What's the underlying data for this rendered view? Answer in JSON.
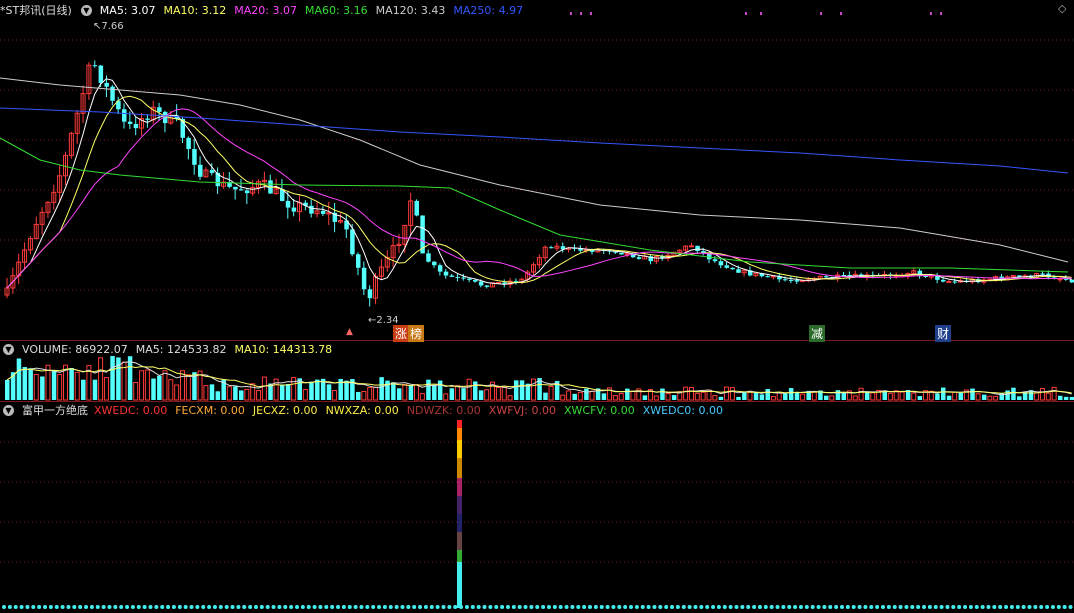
{
  "main": {
    "stock_title": "*ST邦讯(日线)",
    "indicators": [
      {
        "label": "MA5: 3.07",
        "color": "#ffffff"
      },
      {
        "label": "MA10: 3.12",
        "color": "#ffff66"
      },
      {
        "label": "MA20: 3.07",
        "color": "#ff44ff"
      },
      {
        "label": "MA60: 3.16",
        "color": "#33dd33"
      },
      {
        "label": "MA120: 3.43",
        "color": "#cccccc"
      },
      {
        "label": "MA250: 4.97",
        "color": "#3355ff"
      }
    ],
    "high_label": "7.66",
    "low_label": "2.34",
    "tags": [
      {
        "text": "涨",
        "bg": "#c83c14",
        "fg": "#ffffff"
      },
      {
        "text": "榜",
        "bg": "#c87814",
        "fg": "#ffffff"
      },
      {
        "text": "减",
        "bg": "#2a6a2a",
        "fg": "#ffffff"
      },
      {
        "text": "财",
        "bg": "#1f3f8a",
        "fg": "#ffffff"
      }
    ],
    "corner_icon": "◇"
  },
  "volume": {
    "title": "VOLUME: 86922.07",
    "ma5": "MA5: 124533.82",
    "ma10": "MA10: 144313.78"
  },
  "indicator_panel": {
    "title": "富甲一方绝底",
    "items": [
      {
        "label": "XWEDC: 0.00",
        "color": "#ff3333"
      },
      {
        "label": "FECXM: 0.00",
        "color": "#ffaa33"
      },
      {
        "label": "JECXZ: 0.00",
        "color": "#ffee44"
      },
      {
        "label": "NWXZA: 0.00",
        "color": "#ffee44"
      },
      {
        "label": "NDWZK: 0.00",
        "color": "#aa3333"
      },
      {
        "label": "XWFVJ: 0.00",
        "color": "#cc4444"
      },
      {
        "label": "XWCFV: 0.00",
        "color": "#33dd33"
      },
      {
        "label": "XWEDC0: 0.00",
        "color": "#44ccff"
      }
    ]
  },
  "colors": {
    "up": "#ff3b3b",
    "down": "#54ffff",
    "grid": "#7a1a1a"
  }
}
